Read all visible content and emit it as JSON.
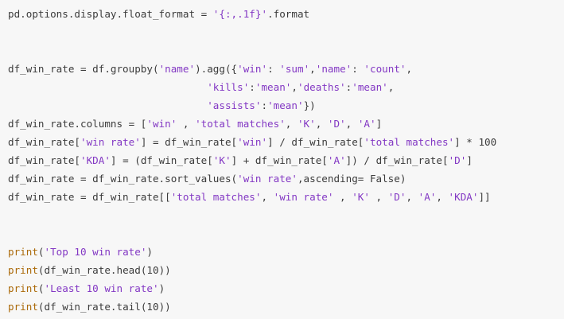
{
  "code": {
    "language": "python",
    "colors": {
      "background": "#f7f7f7",
      "plain": "#3b3b3b",
      "string": "#8338c4",
      "function": "#ab6a0a"
    },
    "lines": [
      [
        {
          "t": "plain",
          "v": "pd.options.display.float_format = "
        },
        {
          "t": "string",
          "v": "'{:,.1f}'"
        },
        {
          "t": "plain",
          "v": ".format"
        }
      ],
      [],
      [],
      [
        {
          "t": "plain",
          "v": "df_win_rate = df.groupby("
        },
        {
          "t": "string",
          "v": "'name'"
        },
        {
          "t": "plain",
          "v": ").agg({"
        },
        {
          "t": "string",
          "v": "'win'"
        },
        {
          "t": "plain",
          "v": ": "
        },
        {
          "t": "string",
          "v": "'sum'"
        },
        {
          "t": "plain",
          "v": ","
        },
        {
          "t": "string",
          "v": "'name'"
        },
        {
          "t": "plain",
          "v": ": "
        },
        {
          "t": "string",
          "v": "'count'"
        },
        {
          "t": "plain",
          "v": ","
        }
      ],
      [
        {
          "t": "plain",
          "v": "                                 "
        },
        {
          "t": "string",
          "v": "'kills'"
        },
        {
          "t": "plain",
          "v": ":"
        },
        {
          "t": "string",
          "v": "'mean'"
        },
        {
          "t": "plain",
          "v": ","
        },
        {
          "t": "string",
          "v": "'deaths'"
        },
        {
          "t": "plain",
          "v": ":"
        },
        {
          "t": "string",
          "v": "'mean'"
        },
        {
          "t": "plain",
          "v": ","
        }
      ],
      [
        {
          "t": "plain",
          "v": "                                 "
        },
        {
          "t": "string",
          "v": "'assists'"
        },
        {
          "t": "plain",
          "v": ":"
        },
        {
          "t": "string",
          "v": "'mean'"
        },
        {
          "t": "plain",
          "v": "})"
        }
      ],
      [
        {
          "t": "plain",
          "v": "df_win_rate.columns = ["
        },
        {
          "t": "string",
          "v": "'win'"
        },
        {
          "t": "plain",
          "v": " , "
        },
        {
          "t": "string",
          "v": "'total matches'"
        },
        {
          "t": "plain",
          "v": ", "
        },
        {
          "t": "string",
          "v": "'K'"
        },
        {
          "t": "plain",
          "v": ", "
        },
        {
          "t": "string",
          "v": "'D'"
        },
        {
          "t": "plain",
          "v": ", "
        },
        {
          "t": "string",
          "v": "'A'"
        },
        {
          "t": "plain",
          "v": "]"
        }
      ],
      [
        {
          "t": "plain",
          "v": "df_win_rate["
        },
        {
          "t": "string",
          "v": "'win rate'"
        },
        {
          "t": "plain",
          "v": "] = df_win_rate["
        },
        {
          "t": "string",
          "v": "'win'"
        },
        {
          "t": "plain",
          "v": "] / df_win_rate["
        },
        {
          "t": "string",
          "v": "'total matches'"
        },
        {
          "t": "plain",
          "v": "] * 100"
        }
      ],
      [
        {
          "t": "plain",
          "v": "df_win_rate["
        },
        {
          "t": "string",
          "v": "'KDA'"
        },
        {
          "t": "plain",
          "v": "] = (df_win_rate["
        },
        {
          "t": "string",
          "v": "'K'"
        },
        {
          "t": "plain",
          "v": "] + df_win_rate["
        },
        {
          "t": "string",
          "v": "'A'"
        },
        {
          "t": "plain",
          "v": "]) / df_win_rate["
        },
        {
          "t": "string",
          "v": "'D'"
        },
        {
          "t": "plain",
          "v": "]"
        }
      ],
      [
        {
          "t": "plain",
          "v": "df_win_rate = df_win_rate.sort_values("
        },
        {
          "t": "string",
          "v": "'win rate'"
        },
        {
          "t": "plain",
          "v": ",ascending= False)"
        }
      ],
      [
        {
          "t": "plain",
          "v": "df_win_rate = df_win_rate[["
        },
        {
          "t": "string",
          "v": "'total matches'"
        },
        {
          "t": "plain",
          "v": ", "
        },
        {
          "t": "string",
          "v": "'win rate'"
        },
        {
          "t": "plain",
          "v": " , "
        },
        {
          "t": "string",
          "v": "'K'"
        },
        {
          "t": "plain",
          "v": " , "
        },
        {
          "t": "string",
          "v": "'D'"
        },
        {
          "t": "plain",
          "v": ", "
        },
        {
          "t": "string",
          "v": "'A'"
        },
        {
          "t": "plain",
          "v": ", "
        },
        {
          "t": "string",
          "v": "'KDA'"
        },
        {
          "t": "plain",
          "v": "]]"
        }
      ],
      [],
      [],
      [
        {
          "t": "func",
          "v": "print"
        },
        {
          "t": "plain",
          "v": "("
        },
        {
          "t": "string",
          "v": "'Top 10 win rate'"
        },
        {
          "t": "plain",
          "v": ")"
        }
      ],
      [
        {
          "t": "func",
          "v": "print"
        },
        {
          "t": "plain",
          "v": "(df_win_rate.head(10))"
        }
      ],
      [
        {
          "t": "func",
          "v": "print"
        },
        {
          "t": "plain",
          "v": "("
        },
        {
          "t": "string",
          "v": "'Least 10 win rate'"
        },
        {
          "t": "plain",
          "v": ")"
        }
      ],
      [
        {
          "t": "func",
          "v": "print"
        },
        {
          "t": "plain",
          "v": "(df_win_rate.tail(10))"
        }
      ]
    ]
  }
}
